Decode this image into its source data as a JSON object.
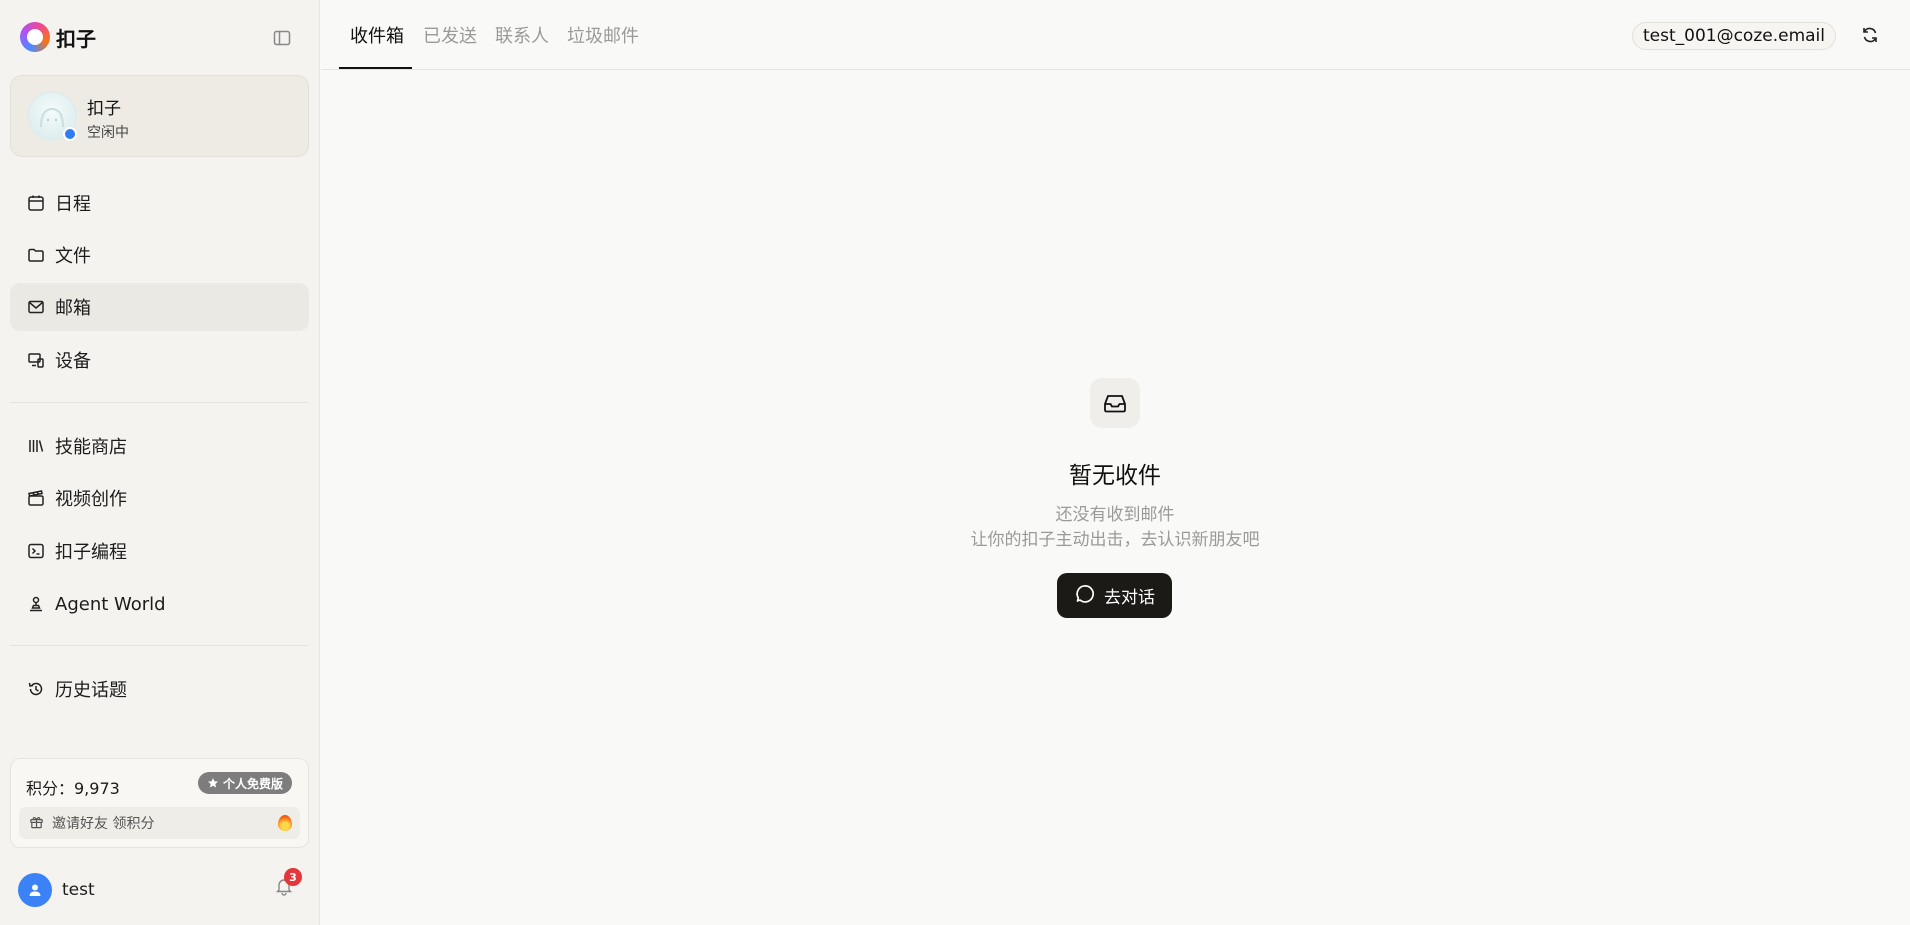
{
  "brand": {
    "name": "扣子"
  },
  "profile": {
    "name": "扣子",
    "status": "空闲中"
  },
  "nav": {
    "schedule": "日程",
    "files": "文件",
    "mailbox": "邮箱",
    "devices": "设备",
    "skill_store": "技能商店",
    "video_creation": "视频创作",
    "coze_coding": "扣子编程",
    "agent_world": "Agent World",
    "history": "历史话题"
  },
  "points": {
    "label": "积分：9,973",
    "plan": "个人免费版",
    "invite": "邀请好友 领积分"
  },
  "user": {
    "name": "test",
    "notifications": "3"
  },
  "tabs": {
    "inbox": "收件箱",
    "sent": "已发送",
    "contacts": "联系人",
    "spam": "垃圾邮件"
  },
  "account": {
    "email": "test_001@coze.email"
  },
  "empty": {
    "title": "暂无收件",
    "line1": "还没有收到邮件",
    "line2": "让你的扣子主动出击，去认识新朋友吧",
    "cta": "去对话"
  },
  "icons": [
    "calendar-icon",
    "folder-icon",
    "mail-icon",
    "device-icon",
    "library-icon",
    "clapperboard-icon",
    "terminal-icon",
    "agent-icon",
    "history-icon",
    "gift-icon",
    "bell-icon",
    "refresh-icon",
    "inbox-icon",
    "chat-icon",
    "sidebar-toggle-icon",
    "star-icon",
    "user-icon"
  ],
  "colors": {
    "accent": "#2f7cf6",
    "cta_bg": "#1c1a17",
    "badge": "#e5373b",
    "sidebar_bg": "#f4f3ef",
    "main_bg": "#f9f9f7"
  }
}
